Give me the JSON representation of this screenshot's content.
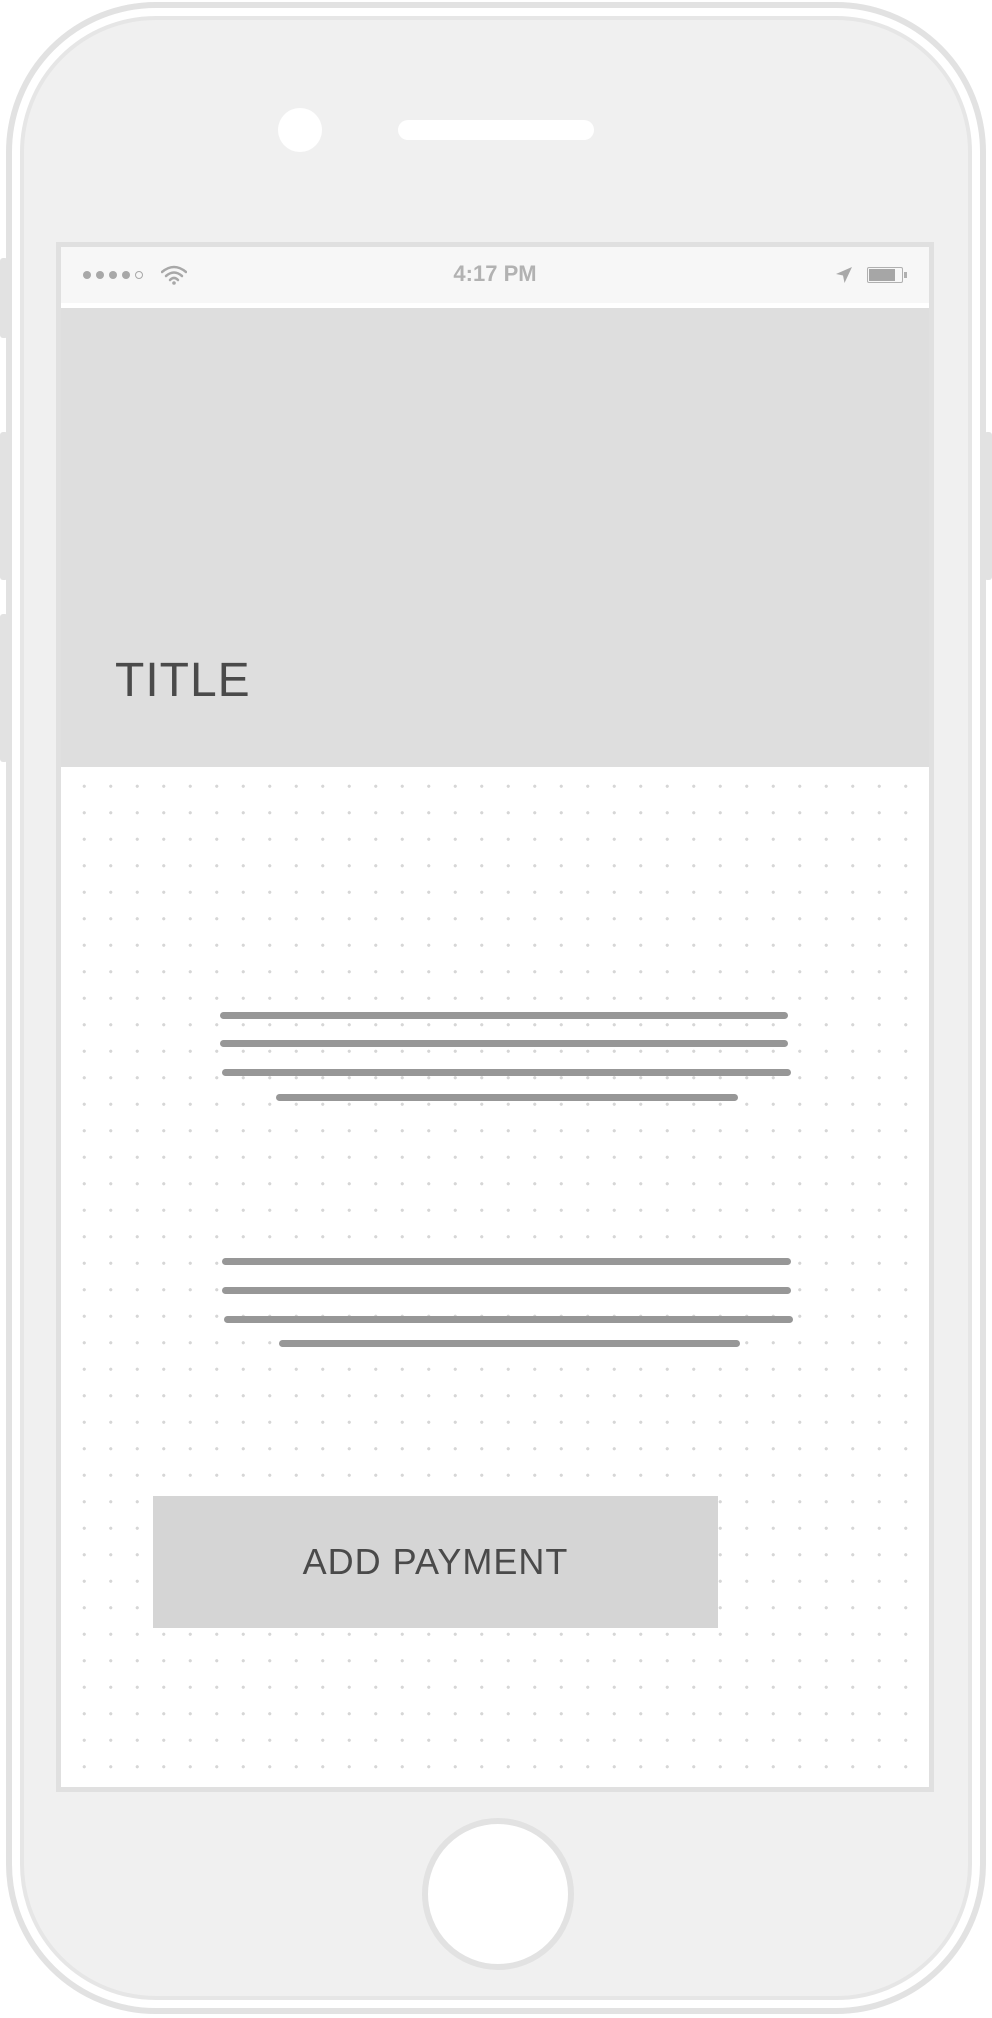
{
  "status_bar": {
    "time": "4:17 PM",
    "signal_bars": 4,
    "signal_total": 5,
    "battery_level": 0.75,
    "icons": [
      "signal-dots",
      "wifi-icon",
      "location-arrow-icon",
      "battery-icon"
    ]
  },
  "header": {
    "title": "TITLE"
  },
  "main": {
    "text_blocks": [
      {
        "placeholder_lines": 4
      },
      {
        "placeholder_lines": 4
      }
    ],
    "primary_button": {
      "label": "ADD PAYMENT"
    }
  },
  "colors": {
    "hero_background": "#dedede",
    "button_background": "#d5d5d5",
    "text_dark": "#4a4a4a",
    "placeholder_line": "#979797",
    "device_frame": "#e2e2e2"
  }
}
